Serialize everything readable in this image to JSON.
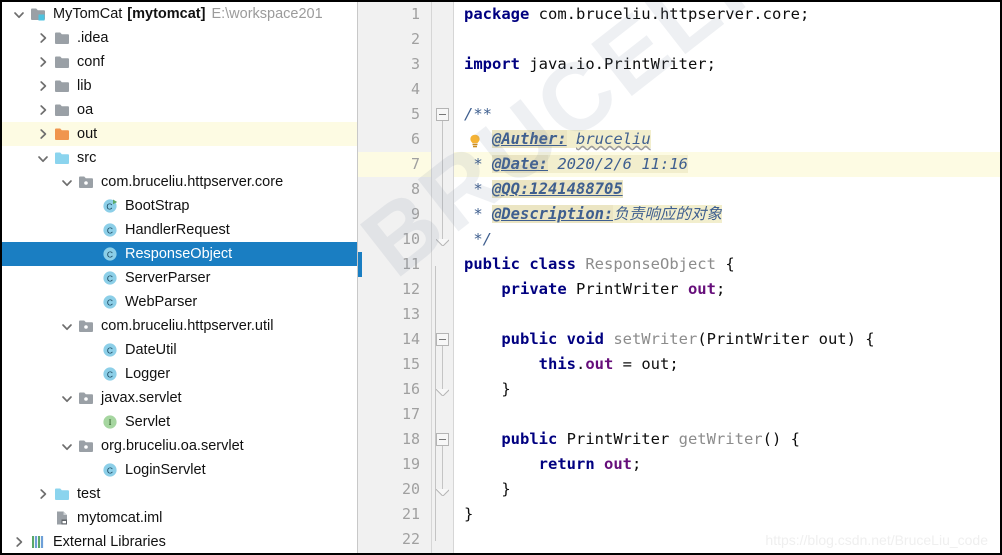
{
  "project_tree": {
    "rows": [
      {
        "indent": 0,
        "twisty": "chevron-down-icon",
        "icon": "project-module-icon",
        "label": "MyTomCat",
        "bold_suffix": "[mytomcat]",
        "dim_suffix": "E:\\workspace201",
        "state": "normal",
        "name": "tree-item-mytomcat"
      },
      {
        "indent": 1,
        "twisty": "chevron-right-icon",
        "icon": "folder-gray-icon",
        "label": ".idea",
        "state": "normal",
        "name": "tree-item-idea"
      },
      {
        "indent": 1,
        "twisty": "chevron-right-icon",
        "icon": "folder-gray-icon",
        "label": "conf",
        "state": "normal",
        "name": "tree-item-conf"
      },
      {
        "indent": 1,
        "twisty": "chevron-right-icon",
        "icon": "folder-gray-icon",
        "label": "lib",
        "state": "normal",
        "name": "tree-item-lib"
      },
      {
        "indent": 1,
        "twisty": "chevron-right-icon",
        "icon": "folder-gray-icon",
        "label": "oa",
        "state": "normal",
        "name": "tree-item-oa"
      },
      {
        "indent": 1,
        "twisty": "chevron-right-icon",
        "icon": "folder-orange-icon",
        "label": "out",
        "state": "highlight",
        "name": "tree-item-out"
      },
      {
        "indent": 1,
        "twisty": "chevron-down-icon",
        "icon": "folder-blue-icon",
        "label": "src",
        "state": "normal",
        "name": "tree-item-src"
      },
      {
        "indent": 2,
        "twisty": "chevron-down-icon",
        "icon": "package-icon",
        "label": "com.bruceliu.httpserver.core",
        "state": "normal",
        "name": "tree-item-package-core"
      },
      {
        "indent": 3,
        "twisty": "none",
        "icon": "class-runnable-icon",
        "label": "BootStrap",
        "state": "normal",
        "name": "tree-item-bootstrap"
      },
      {
        "indent": 3,
        "twisty": "none",
        "icon": "class-icon",
        "label": "HandlerRequest",
        "state": "normal",
        "name": "tree-item-handlerrequest"
      },
      {
        "indent": 3,
        "twisty": "none",
        "icon": "class-icon",
        "label": "ResponseObject",
        "state": "selected",
        "name": "tree-item-responseobject"
      },
      {
        "indent": 3,
        "twisty": "none",
        "icon": "class-icon",
        "label": "ServerParser",
        "state": "normal",
        "name": "tree-item-serverparser"
      },
      {
        "indent": 3,
        "twisty": "none",
        "icon": "class-icon",
        "label": "WebParser",
        "state": "normal",
        "name": "tree-item-webparser"
      },
      {
        "indent": 2,
        "twisty": "chevron-down-icon",
        "icon": "package-icon",
        "label": "com.bruceliu.httpserver.util",
        "state": "normal",
        "name": "tree-item-package-util"
      },
      {
        "indent": 3,
        "twisty": "none",
        "icon": "class-icon",
        "label": "DateUtil",
        "state": "normal",
        "name": "tree-item-dateutil"
      },
      {
        "indent": 3,
        "twisty": "none",
        "icon": "class-icon",
        "label": "Logger",
        "state": "normal",
        "name": "tree-item-logger"
      },
      {
        "indent": 2,
        "twisty": "chevron-down-icon",
        "icon": "package-icon",
        "label": "javax.servlet",
        "state": "normal",
        "name": "tree-item-package-javax-servlet"
      },
      {
        "indent": 3,
        "twisty": "none",
        "icon": "interface-icon",
        "label": "Servlet",
        "state": "normal",
        "name": "tree-item-servlet"
      },
      {
        "indent": 2,
        "twisty": "chevron-down-icon",
        "icon": "package-icon",
        "label": "org.bruceliu.oa.servlet",
        "state": "normal",
        "name": "tree-item-package-oa-servlet"
      },
      {
        "indent": 3,
        "twisty": "none",
        "icon": "class-icon",
        "label": "LoginServlet",
        "state": "normal",
        "name": "tree-item-loginservlet"
      },
      {
        "indent": 1,
        "twisty": "chevron-right-icon",
        "icon": "folder-blue-icon",
        "label": "test",
        "state": "normal",
        "name": "tree-item-test"
      },
      {
        "indent": 1,
        "twisty": "none",
        "icon": "iml-file-icon",
        "label": "mytomcat.iml",
        "state": "normal",
        "name": "tree-item-mytomcat-iml"
      },
      {
        "indent": 0,
        "twisty": "chevron-right-icon",
        "icon": "external-libraries-icon",
        "label": "External Libraries",
        "state": "normal",
        "name": "tree-item-external-libraries"
      }
    ]
  },
  "editor": {
    "line_numbers": [
      "1",
      "2",
      "3",
      "4",
      "5",
      "6",
      "7",
      "8",
      "9",
      "10",
      "11",
      "12",
      "13",
      "14",
      "15",
      "16",
      "17",
      "18",
      "19",
      "20",
      "21",
      "22"
    ],
    "highlighted_line": "7",
    "change_marker_line": "11",
    "lines": [
      {
        "n": "1",
        "tokens": [
          {
            "t": "package ",
            "c": "kw"
          },
          {
            "t": "com.bruceliu.httpserver.core;",
            "c": "pln"
          }
        ]
      },
      {
        "n": "2",
        "tokens": []
      },
      {
        "n": "3",
        "tokens": [
          {
            "t": "import ",
            "c": "kw"
          },
          {
            "t": "java.io.PrintWriter;",
            "c": "pln"
          }
        ]
      },
      {
        "n": "4",
        "tokens": []
      },
      {
        "n": "5",
        "tokens": [
          {
            "t": "/**",
            "c": "jdoc"
          }
        ]
      },
      {
        "n": "6",
        "tokens": [
          {
            "t": "   ",
            "c": "jdoc"
          },
          {
            "t": "@Auther:",
            "c": "jtag"
          },
          {
            "t": " ",
            "c": "jval"
          },
          {
            "t": "bruceliu",
            "c": "jval squig"
          }
        ]
      },
      {
        "n": "7",
        "tokens": [
          {
            "t": " * ",
            "c": "jdoc"
          },
          {
            "t": "@Date:",
            "c": "jtag"
          },
          {
            "t": " 2020/2/6 11:16",
            "c": "jval"
          }
        ]
      },
      {
        "n": "8",
        "tokens": [
          {
            "t": " * ",
            "c": "jdoc"
          },
          {
            "t": "@QQ:1241488705",
            "c": "jtag"
          }
        ]
      },
      {
        "n": "9",
        "tokens": [
          {
            "t": " * ",
            "c": "jdoc"
          },
          {
            "t": "@Description:",
            "c": "jtag"
          },
          {
            "t": "负责响应的对象",
            "c": "jval"
          }
        ]
      },
      {
        "n": "10",
        "tokens": [
          {
            "t": " */",
            "c": "jdoc"
          }
        ]
      },
      {
        "n": "11",
        "tokens": [
          {
            "t": "public class ",
            "c": "kw"
          },
          {
            "t": "ResponseObject",
            "c": "typ"
          },
          {
            "t": " {",
            "c": "pln"
          }
        ]
      },
      {
        "n": "12",
        "tokens": [
          {
            "t": "    ",
            "c": "pln"
          },
          {
            "t": "private ",
            "c": "kw"
          },
          {
            "t": "PrintWriter ",
            "c": "pln"
          },
          {
            "t": "out",
            "c": "fld"
          },
          {
            "t": ";",
            "c": "pln"
          }
        ]
      },
      {
        "n": "13",
        "tokens": []
      },
      {
        "n": "14",
        "tokens": [
          {
            "t": "    ",
            "c": "pln"
          },
          {
            "t": "public void ",
            "c": "kw"
          },
          {
            "t": "setWriter",
            "c": "typ"
          },
          {
            "t": "(PrintWriter out) {",
            "c": "pln"
          }
        ]
      },
      {
        "n": "15",
        "tokens": [
          {
            "t": "        ",
            "c": "pln"
          },
          {
            "t": "this",
            "c": "kw"
          },
          {
            "t": ".",
            "c": "pln"
          },
          {
            "t": "out",
            "c": "fld"
          },
          {
            "t": " = out;",
            "c": "pln"
          }
        ]
      },
      {
        "n": "16",
        "tokens": [
          {
            "t": "    }",
            "c": "pln"
          }
        ]
      },
      {
        "n": "17",
        "tokens": []
      },
      {
        "n": "18",
        "tokens": [
          {
            "t": "    ",
            "c": "pln"
          },
          {
            "t": "public ",
            "c": "kw"
          },
          {
            "t": "PrintWriter ",
            "c": "pln"
          },
          {
            "t": "getWriter",
            "c": "typ"
          },
          {
            "t": "() {",
            "c": "pln"
          }
        ]
      },
      {
        "n": "19",
        "tokens": [
          {
            "t": "        ",
            "c": "pln"
          },
          {
            "t": "return ",
            "c": "kw"
          },
          {
            "t": "out",
            "c": "fld"
          },
          {
            "t": ";",
            "c": "pln"
          }
        ]
      },
      {
        "n": "20",
        "tokens": [
          {
            "t": "    }",
            "c": "pln"
          }
        ]
      },
      {
        "n": "21",
        "tokens": [
          {
            "t": "}",
            "c": "pln"
          }
        ]
      },
      {
        "n": "22",
        "tokens": []
      }
    ]
  },
  "watermarks": {
    "diagonal": "BRUCELIU",
    "url": "https://blog.csdn.net/BruceLiu_code"
  },
  "colors": {
    "selection_blue": "#1a7ec2",
    "highlight_yellow": "#fdfbe3",
    "javadoc_bg": "#f2eecd",
    "keyword": "#000080",
    "field_purple": "#660e7a",
    "type_gray": "#8c8c8c",
    "gutter_bg": "#f1f1f1",
    "folder_orange": "#f0954e",
    "folder_blue": "#8bd4ee"
  }
}
